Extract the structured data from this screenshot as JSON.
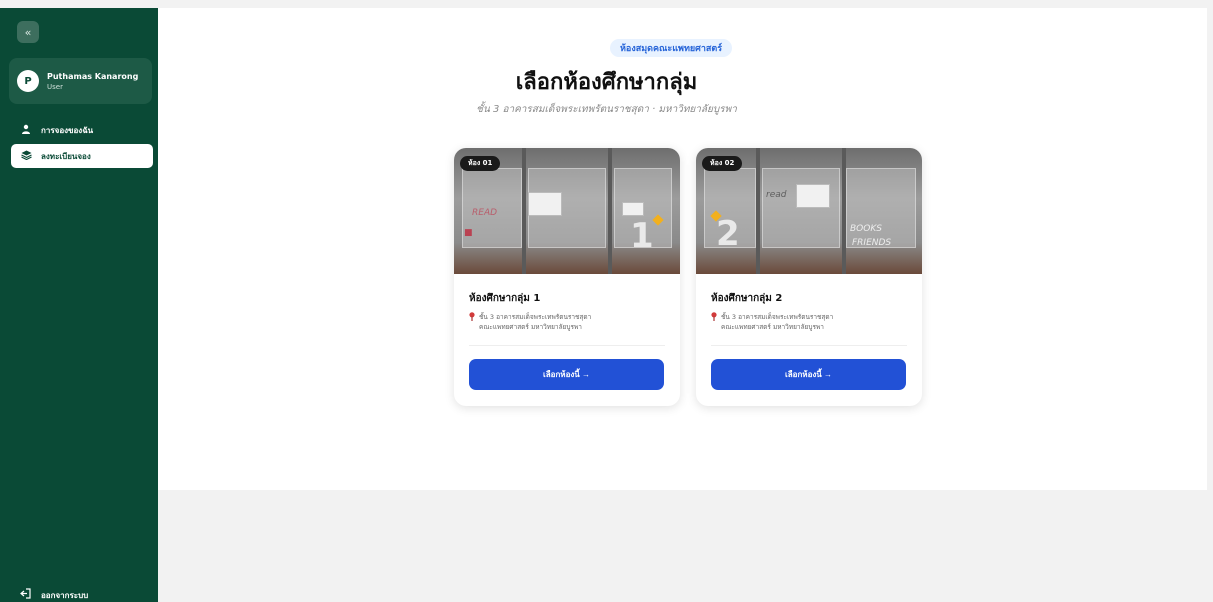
{
  "sidebar": {
    "collapse_icon_glyph": "«",
    "user": {
      "initial": "P",
      "name": "Puthamas Kanarong",
      "role": "User"
    },
    "items": [
      {
        "label": "การจองของฉัน",
        "icon": "user-icon"
      },
      {
        "label": "ลงทะเบียนจอง",
        "icon": "layers-icon"
      }
    ],
    "logout": {
      "label": "ออกจากระบบ",
      "icon": "logout-icon"
    }
  },
  "header": {
    "badge": "ห้องสมุดคณะแพทยศาสตร์",
    "title": "เลือกห้องศึกษากลุ่ม",
    "subtitle": "ชั้น 3 อาคารสมเด็จพระเทพรัตนราชสุดา · มหาวิทยาลัยบูรพา"
  },
  "rooms": [
    {
      "tag": "ห้อง 01",
      "photo_number": "1",
      "name": "ห้องศึกษากลุ่ม 1",
      "location_line1": "ชั้น 3 อาคารสมเด็จพระเทพรัตนราชสุดา",
      "location_line2": "คณะแพทยศาสตร์ มหาวิทยาลัยบูรพา",
      "button": "เลือกห้องนี้ →"
    },
    {
      "tag": "ห้อง 02",
      "photo_number": "2",
      "name": "ห้องศึกษากลุ่ม 2",
      "location_line1": "ชั้น 3 อาคารสมเด็จพระเทพรัตนราชสุดา",
      "location_line2": "คณะแพทยศาสตร์ มหาวิทยาลัยบูรพา",
      "button": "เลือกห้องนี้ →"
    }
  ],
  "colors": {
    "sidebar": "#0a4a36",
    "accent": "#2251d6",
    "badge_bg": "#e8f2ff"
  }
}
